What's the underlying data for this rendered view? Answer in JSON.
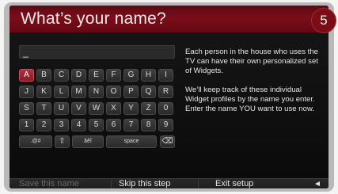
{
  "header": {
    "title": "What’s your name?",
    "step": "5"
  },
  "input": {
    "value": "_"
  },
  "keyboard": {
    "rows": [
      [
        "A",
        "B",
        "C",
        "D",
        "E",
        "F",
        "G",
        "H",
        "I"
      ],
      [
        "J",
        "K",
        "L",
        "M",
        "N",
        "O",
        "P",
        "Q",
        "R"
      ],
      [
        "S",
        "T",
        "U",
        "V",
        "W",
        "X",
        "Y",
        "Z",
        "0"
      ],
      [
        "1",
        "2",
        "3",
        "4",
        "5",
        "6",
        "7",
        "8",
        "9"
      ]
    ],
    "selected_key": "A",
    "special": {
      "symbols": ".@#",
      "shift": "⇧",
      "accents": "âêî",
      "space": "space",
      "backspace": "⌫"
    }
  },
  "description": {
    "p1": "Each person in the house who uses the TV can have their own personalized set of Widgets.",
    "p2": "We’ll keep track of these individual Widget profiles by the name you enter. Enter the name YOU want to use now."
  },
  "footer": {
    "save": "Save this name",
    "skip": "Skip this step",
    "exit": "Exit setup",
    "back": "◄"
  },
  "colors": {
    "accent": "#7a0d1a",
    "selected_key": "#9e2230"
  }
}
